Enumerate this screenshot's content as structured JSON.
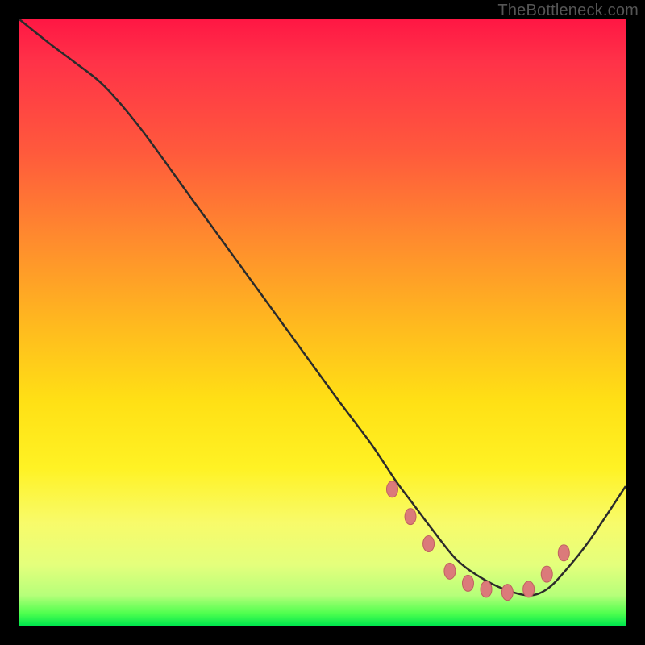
{
  "watermark": "TheBottleneck.com",
  "colors": {
    "curve": "#2b2b2b",
    "marker_fill": "#db7a7a",
    "marker_stroke": "#c06060",
    "background_black": "#000000"
  },
  "chart_data": {
    "type": "line",
    "title": "",
    "xlabel": "",
    "ylabel": "",
    "xlim": [
      0,
      100
    ],
    "ylim": [
      0,
      100
    ],
    "grid": false,
    "legend": false,
    "axes_visible": false,
    "series": [
      {
        "name": "bottleneck-curve",
        "x": [
          0,
          5,
          9,
          14,
          20,
          28,
          36,
          44,
          52,
          58,
          62,
          65,
          68,
          72,
          76,
          80,
          84,
          87,
          90,
          94,
          100
        ],
        "y": [
          100,
          96,
          93,
          89,
          82,
          71,
          60,
          49,
          38,
          30,
          24,
          20,
          16,
          11,
          8,
          6,
          5,
          6,
          9,
          14,
          23
        ]
      }
    ],
    "markers": [
      {
        "x": 61.5,
        "y": 22.5
      },
      {
        "x": 64.5,
        "y": 18.0
      },
      {
        "x": 67.5,
        "y": 13.5
      },
      {
        "x": 71.0,
        "y": 9.0
      },
      {
        "x": 74.0,
        "y": 7.0
      },
      {
        "x": 77.0,
        "y": 6.0
      },
      {
        "x": 80.5,
        "y": 5.5
      },
      {
        "x": 84.0,
        "y": 6.0
      },
      {
        "x": 87.0,
        "y": 8.5
      },
      {
        "x": 89.8,
        "y": 12.0
      }
    ],
    "marker_style": {
      "shape": "ellipse",
      "rx": 7,
      "ry": 10,
      "color": "#db7a7a"
    }
  }
}
